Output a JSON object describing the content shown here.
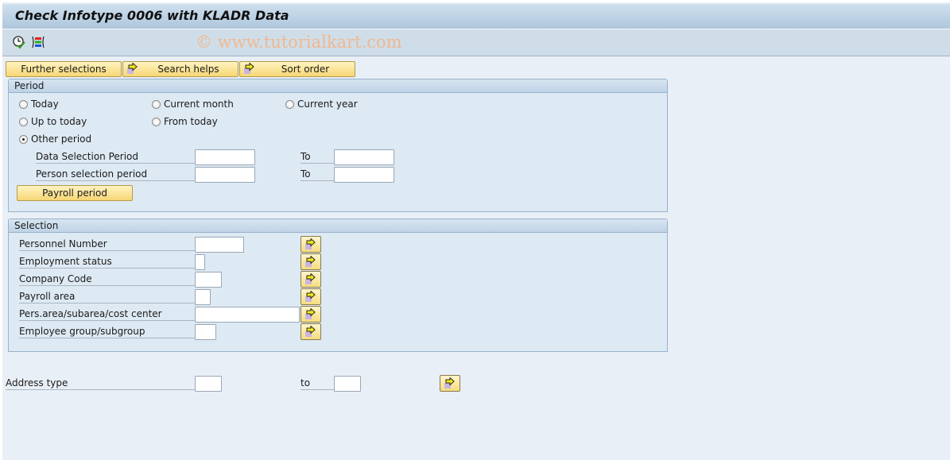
{
  "window": {
    "title": "Check Infotype 0006 with KLADR Data",
    "watermark": "© www.tutorialkart.com"
  },
  "toolbar": {
    "icons": [
      "execute-clock-icon",
      "selection-variant-icon"
    ]
  },
  "actions": {
    "further_selections": "Further selections",
    "search_helps": "Search helps",
    "sort_order": "Sort order"
  },
  "period": {
    "title": "Period",
    "radios": [
      {
        "label": "Today",
        "selected": false
      },
      {
        "label": "Current month",
        "selected": false
      },
      {
        "label": "Current year",
        "selected": false
      },
      {
        "label": "Up to today",
        "selected": false
      },
      {
        "label": "From today",
        "selected": false
      },
      {
        "label": "Other period",
        "selected": true
      }
    ],
    "data_selection_label": "Data Selection Period",
    "data_selection_from": "",
    "data_selection_to_label": "To",
    "data_selection_to": "",
    "person_selection_label": "Person selection period",
    "person_selection_from": "",
    "person_selection_to_label": "To",
    "person_selection_to": "",
    "payroll_period_button": "Payroll period"
  },
  "selection": {
    "title": "Selection",
    "fields": [
      {
        "label": "Personnel Number",
        "value": ""
      },
      {
        "label": "Employment status",
        "value": ""
      },
      {
        "label": "Company Code",
        "value": ""
      },
      {
        "label": "Payroll area",
        "value": ""
      },
      {
        "label": "Pers.area/subarea/cost center",
        "value": ""
      },
      {
        "label": "Employee group/subgroup",
        "value": ""
      }
    ]
  },
  "address": {
    "label": "Address type",
    "from": "",
    "to_label": "to",
    "to": ""
  }
}
